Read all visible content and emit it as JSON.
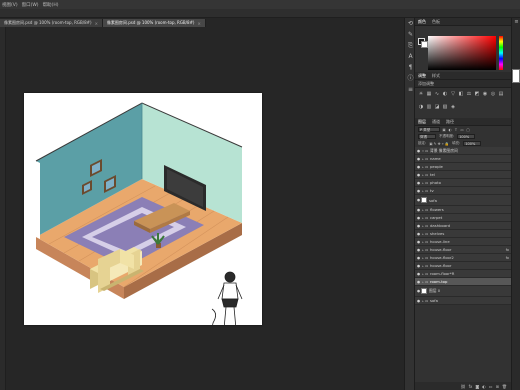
{
  "menubar": {
    "items": [
      "视图(V)",
      "窗口(W)",
      "帮助(H)"
    ]
  },
  "tabs": [
    {
      "label": "像素图房间.psd @ 100% (room-top, RGB/8#)",
      "active": false
    },
    {
      "label": "像素图房间.psd @ 100% (room-top, RGB/8#)",
      "active": true
    }
  ],
  "color_panel": {
    "tabs": [
      "颜色",
      "色板"
    ],
    "hue_color": "#ff0000"
  },
  "adjustments_panel": {
    "tabs": [
      "调整",
      "样式"
    ],
    "add_label": "添加调整",
    "icons": [
      "brightness-icon",
      "curves-icon",
      "levels-icon",
      "exposure-icon",
      "vibrance-icon",
      "hue-icon",
      "balance-icon",
      "bw-icon",
      "photo-filter-icon",
      "channel-mixer-icon",
      "lookup-icon",
      "invert-icon",
      "posterize-icon",
      "threshold-icon",
      "gradient-map-icon",
      "selective-color-icon"
    ]
  },
  "layers_panel": {
    "tabs": [
      "图层",
      "通道",
      "路径"
    ],
    "filter_label": "P 类型",
    "blend_mode": "穿透",
    "opacity_label": "不透明度:",
    "opacity_value": "100%",
    "lock_label": "锁定:",
    "fill_label": "填充:",
    "fill_value": "100%",
    "layers": [
      {
        "name": "背景 像素图房间",
        "type": "group",
        "expanded": true,
        "fx": false,
        "selected": false,
        "visible": true
      },
      {
        "name": "name",
        "type": "layer",
        "fx": false,
        "selected": false,
        "visible": true
      },
      {
        "name": "people",
        "type": "group",
        "fx": false,
        "selected": false,
        "visible": true
      },
      {
        "name": "tel",
        "type": "group",
        "fx": false,
        "selected": false,
        "visible": true
      },
      {
        "name": "photo",
        "type": "group",
        "fx": false,
        "selected": false,
        "visible": true
      },
      {
        "name": "tv",
        "type": "group",
        "fx": false,
        "selected": false,
        "visible": true
      },
      {
        "name": "sofa",
        "type": "thumb",
        "fx": false,
        "selected": false,
        "visible": true
      },
      {
        "name": "flowers",
        "type": "group",
        "fx": false,
        "selected": false,
        "visible": true
      },
      {
        "name": "carpet",
        "type": "group",
        "fx": false,
        "selected": false,
        "visible": true
      },
      {
        "name": "dashboard",
        "type": "group",
        "fx": false,
        "selected": false,
        "visible": true
      },
      {
        "name": "shelves",
        "type": "group",
        "fx": false,
        "selected": false,
        "visible": true
      },
      {
        "name": "house-line",
        "type": "group",
        "fx": false,
        "selected": false,
        "visible": true
      },
      {
        "name": "house-floor",
        "type": "group",
        "fx": true,
        "selected": false,
        "visible": true
      },
      {
        "name": "house-floor2",
        "type": "group",
        "fx": true,
        "selected": false,
        "visible": true
      },
      {
        "name": "house-floor",
        "type": "group",
        "fx": false,
        "selected": false,
        "visible": true
      },
      {
        "name": "room-floor*R",
        "type": "group",
        "fx": false,
        "selected": false,
        "visible": true
      },
      {
        "name": "room-top",
        "type": "group",
        "fx": false,
        "selected": true,
        "visible": true
      },
      {
        "name": "图层 0",
        "type": "thumb",
        "fx": false,
        "selected": false,
        "visible": true
      },
      {
        "name": "sofa",
        "type": "group",
        "fx": false,
        "selected": false,
        "visible": true
      }
    ]
  },
  "illustration": {
    "wall_left_color": "#5b9fa6",
    "wall_right_color": "#b7e3d3",
    "floor_color": "#e9a86c",
    "carpet_color": "#8b7fb6",
    "sofa_color": "#f1e2a6"
  }
}
